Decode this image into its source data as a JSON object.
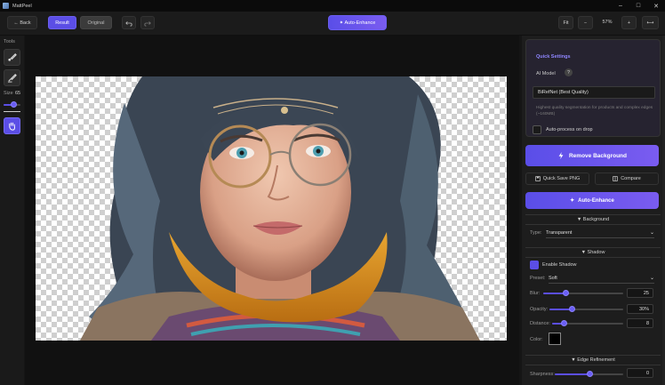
{
  "window": {
    "title": "MattPeel",
    "min": "–",
    "max": "□",
    "close": "✕"
  },
  "toolbar": {
    "back": "← Back",
    "result": "Result",
    "original": "Original",
    "auto_enhance": "✦ Auto-Enhance",
    "fit": "Fit",
    "zoom_out": "−",
    "zoom_level": "57%",
    "zoom_in": "+",
    "menu": "⟷"
  },
  "tools": {
    "title": "Tools",
    "size_label": "Size",
    "size_value": "65",
    "size_fraction": 0.6
  },
  "panel": {
    "quick_settings": "Quick Settings",
    "ai_model_label": "AI Model",
    "ai_model_help": "?",
    "ai_model_value": "BiRefNet (Best Quality)",
    "ai_model_desc": "Highest quality segmentation for products and complex edges (~160MB)",
    "auto_process": "Auto-process on drop",
    "remove_bg": "Remove Background",
    "quick_save": "Quick Save PNG",
    "compare": "Compare",
    "auto_enhance": "Auto-Enhance",
    "background_section": "▼ Background",
    "type_label": "Type:",
    "type_value": "Transparent",
    "shadow_section": "▼ Shadow",
    "enable_shadow": "Enable Shadow",
    "preset_label": "Preset:",
    "preset_value": "Soft",
    "blur_label": "Blur:",
    "blur_value": "25",
    "blur_fraction": 0.28,
    "opacity_label": "Opacity:",
    "opacity_value": "30%",
    "opacity_fraction": 0.3,
    "distance_label": "Distance:",
    "distance_value": "8",
    "distance_fraction": 0.16,
    "color_label": "Color:",
    "edge_section": "▼ Edge Refinement",
    "sharpness_label": "Sharpness:",
    "sharpness_value": "0",
    "sharpness_fraction": 0.5
  },
  "colors": {
    "accent": "#5b4ee6",
    "swatch": "#000000"
  }
}
